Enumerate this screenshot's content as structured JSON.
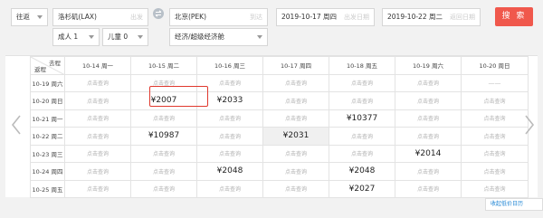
{
  "search": {
    "trip_type": "往返",
    "from_city": "洛杉矶(LAX)",
    "from_hint": "出发",
    "to_city": "北京(PEK)",
    "to_hint": "到达",
    "depart_date": "2019-10-17 周四",
    "depart_hint": "出发日期",
    "return_date": "2019-10-22 周二",
    "return_hint": "返回日期",
    "adults": "成人 1",
    "children": "儿童 0",
    "cabin": "经济/超级经济舱",
    "search_label": "搜 索"
  },
  "calendar": {
    "depart_header": "去程",
    "return_header": "返程",
    "columns": [
      "10-14 周一",
      "10-15 周二",
      "10-16 周三",
      "10-17 周四",
      "10-18 周五",
      "10-19 周六",
      "10-20 周日"
    ],
    "rows": [
      {
        "label": "10-19 周六",
        "cells": [
          "点击查询",
          "点击查询",
          "点击查询",
          "点击查询",
          "点击查询",
          "点击查询",
          "——"
        ]
      },
      {
        "label": "10-20 周日",
        "cells": [
          "点击查询",
          "¥2007",
          "¥2033",
          "点击查询",
          "点击查询",
          "点击查询",
          "点击查询"
        ]
      },
      {
        "label": "10-21 周一",
        "cells": [
          "点击查询",
          "点击查询",
          "点击查询",
          "点击查询",
          "¥10377",
          "点击查询",
          "点击查询"
        ]
      },
      {
        "label": "10-22 周二",
        "cells": [
          "点击查询",
          "¥10987",
          "点击查询",
          "¥2031",
          "点击查询",
          "点击查询",
          "点击查询"
        ]
      },
      {
        "label": "10-23 周三",
        "cells": [
          "点击查询",
          "点击查询",
          "点击查询",
          "点击查询",
          "点击查询",
          "¥2014",
          "点击查询"
        ]
      },
      {
        "label": "10-24 周四",
        "cells": [
          "点击查询",
          "点击查询",
          "¥2048",
          "点击查询",
          "¥2048",
          "点击查询",
          "点击查询"
        ]
      },
      {
        "label": "10-25 周五",
        "cells": [
          "点击查询",
          "点击查询",
          "点击查询",
          "点击查询",
          "¥2027",
          "点击查询",
          "点击查询"
        ]
      }
    ]
  },
  "history_label": "收起低价日历"
}
